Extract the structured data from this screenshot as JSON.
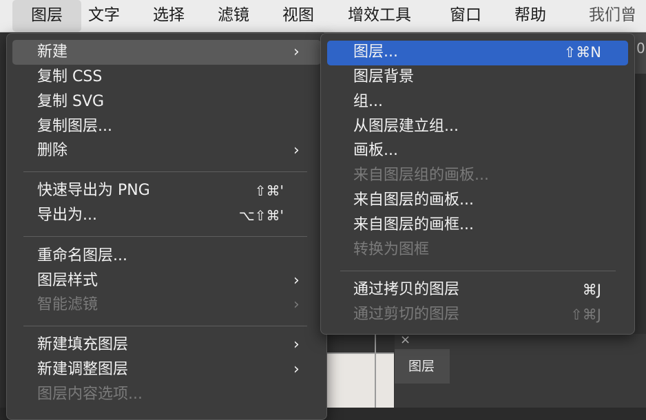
{
  "menubar": {
    "items": [
      "图层",
      "文字",
      "选择",
      "滤镜",
      "视图",
      "增效工具",
      "窗口",
      "帮助",
      "我们曾"
    ]
  },
  "layer_menu": {
    "items": [
      {
        "label": "新建",
        "submenu": true
      },
      {
        "label": "复制 CSS"
      },
      {
        "label": "复制 SVG"
      },
      {
        "label": "复制图层..."
      },
      {
        "label": "删除",
        "submenu": true
      },
      {
        "label": "快速导出为 PNG",
        "shortcut": "⇧⌘'"
      },
      {
        "label": "导出为...",
        "shortcut": "⌥⇧⌘'"
      },
      {
        "label": "重命名图层..."
      },
      {
        "label": "图层样式",
        "submenu": true
      },
      {
        "label": "智能滤镜",
        "submenu": true,
        "disabled": true
      },
      {
        "label": "新建填充图层",
        "submenu": true
      },
      {
        "label": "新建调整图层",
        "submenu": true
      },
      {
        "label": "图层内容选项...",
        "disabled": true
      }
    ]
  },
  "new_submenu": {
    "items": [
      {
        "label": "图层...",
        "shortcut": "⇧⌘N",
        "highlighted": true
      },
      {
        "label": "图层背景"
      },
      {
        "label": "组..."
      },
      {
        "label": "从图层建立组..."
      },
      {
        "label": "画板..."
      },
      {
        "label": "来自图层组的画板...",
        "disabled": true
      },
      {
        "label": "来自图层的画板..."
      },
      {
        "label": "来自图层的画框..."
      },
      {
        "label": "转换为图框",
        "disabled": true
      },
      {
        "label": "通过拷贝的图层",
        "shortcut": "⌘J"
      },
      {
        "label": "通过剪切的图层",
        "shortcut": "⇧⌘J",
        "disabled": true
      }
    ]
  },
  "bg_fragment": "0",
  "layers_panel": {
    "tab": "图层",
    "close": "×"
  },
  "colors": {
    "highlight": "#2f64c7",
    "menu_bg": "#3c3c3c",
    "disabled_text": "#7a7a7a"
  }
}
